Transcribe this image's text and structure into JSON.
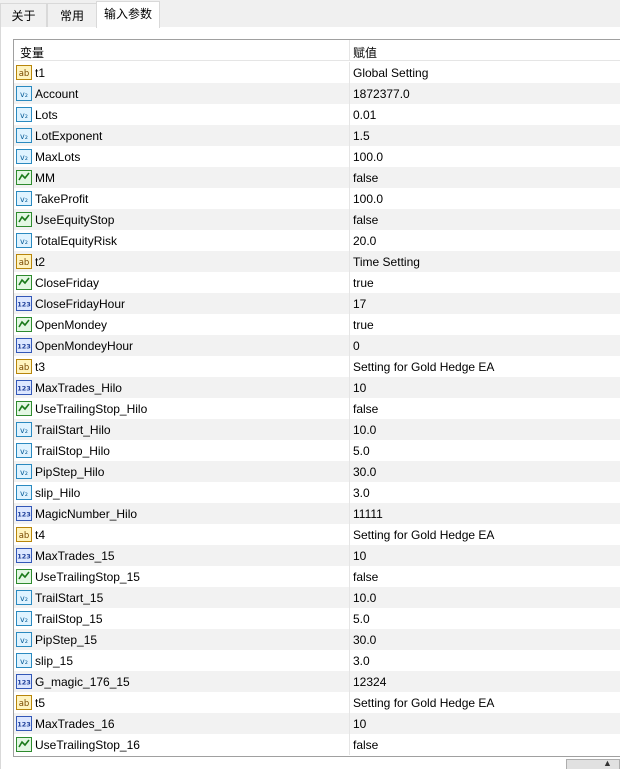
{
  "tabs": [
    {
      "label": "关于",
      "active": false
    },
    {
      "label": "常用",
      "active": false
    },
    {
      "label": "输入参数",
      "active": true
    }
  ],
  "columns": {
    "variable": "变量",
    "value": "赋值"
  },
  "rows": [
    {
      "type": "ab",
      "name": "t1",
      "value": "Global Setting"
    },
    {
      "type": "v2",
      "name": "Account",
      "value": "1872377.0"
    },
    {
      "type": "v2",
      "name": "Lots",
      "value": "0.01"
    },
    {
      "type": "v2",
      "name": "LotExponent",
      "value": "1.5"
    },
    {
      "type": "v2",
      "name": "MaxLots",
      "value": "100.0"
    },
    {
      "type": "bool",
      "name": "MM",
      "value": "false"
    },
    {
      "type": "v2",
      "name": "TakeProfit",
      "value": "100.0"
    },
    {
      "type": "bool",
      "name": "UseEquityStop",
      "value": "false"
    },
    {
      "type": "v2",
      "name": "TotalEquityRisk",
      "value": "20.0"
    },
    {
      "type": "ab",
      "name": "t2",
      "value": "Time Setting"
    },
    {
      "type": "bool",
      "name": "CloseFriday",
      "value": "true"
    },
    {
      "type": "int",
      "name": "CloseFridayHour",
      "value": "17"
    },
    {
      "type": "bool",
      "name": "OpenMondey",
      "value": "true"
    },
    {
      "type": "int",
      "name": "OpenMondeyHour",
      "value": "0"
    },
    {
      "type": "ab",
      "name": "t3",
      "value": "Setting for Gold Hedge EA"
    },
    {
      "type": "int",
      "name": "MaxTrades_Hilo",
      "value": "10"
    },
    {
      "type": "bool",
      "name": "UseTrailingStop_Hilo",
      "value": "false"
    },
    {
      "type": "v2",
      "name": "TrailStart_Hilo",
      "value": "10.0"
    },
    {
      "type": "v2",
      "name": "TrailStop_Hilo",
      "value": "5.0"
    },
    {
      "type": "v2",
      "name": "PipStep_Hilo",
      "value": "30.0"
    },
    {
      "type": "v2",
      "name": "slip_Hilo",
      "value": "3.0"
    },
    {
      "type": "int",
      "name": "MagicNumber_Hilo",
      "value": "11111"
    },
    {
      "type": "ab",
      "name": "t4",
      "value": "Setting for Gold Hedge EA"
    },
    {
      "type": "int",
      "name": "MaxTrades_15",
      "value": "10"
    },
    {
      "type": "bool",
      "name": "UseTrailingStop_15",
      "value": "false"
    },
    {
      "type": "v2",
      "name": "TrailStart_15",
      "value": "10.0"
    },
    {
      "type": "v2",
      "name": "TrailStop_15",
      "value": "5.0"
    },
    {
      "type": "v2",
      "name": "PipStep_15",
      "value": "30.0"
    },
    {
      "type": "v2",
      "name": "slip_15",
      "value": "3.0"
    },
    {
      "type": "int",
      "name": "G_magic_176_15",
      "value": "12324"
    },
    {
      "type": "ab",
      "name": "t5",
      "value": "Setting for Gold Hedge EA"
    },
    {
      "type": "int",
      "name": "MaxTrades_16",
      "value": "10"
    },
    {
      "type": "bool",
      "name": "UseTrailingStop_16",
      "value": "false"
    }
  ]
}
